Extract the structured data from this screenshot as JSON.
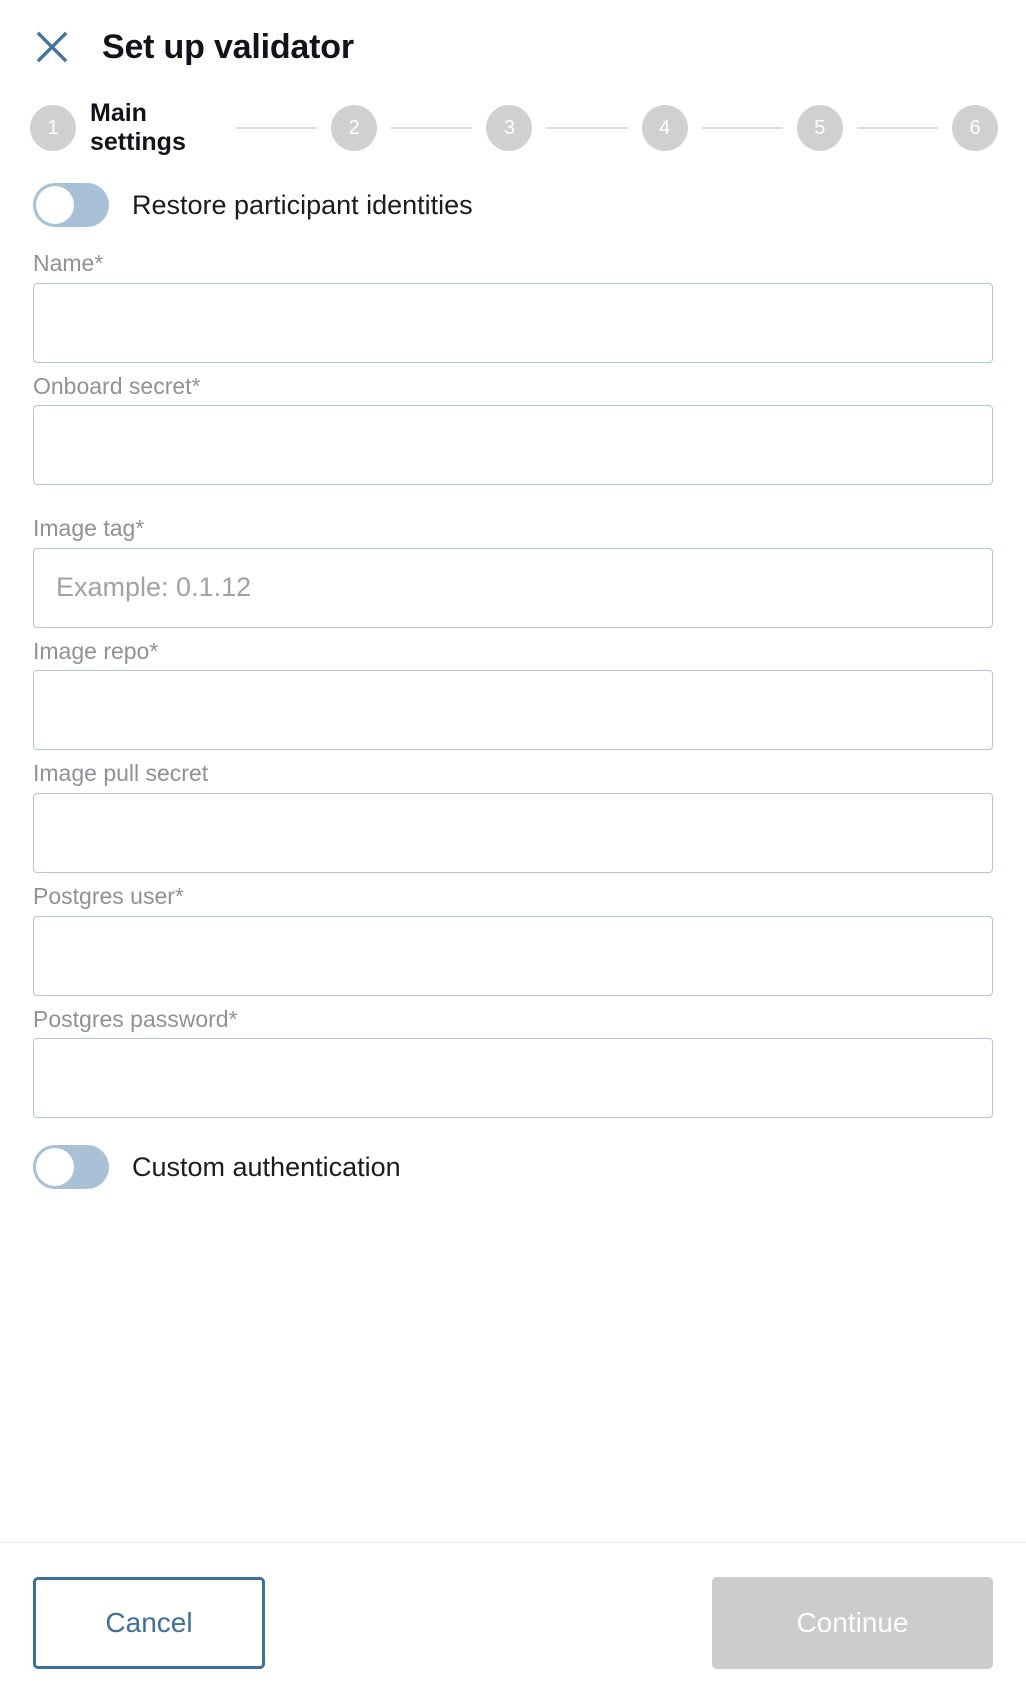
{
  "header": {
    "close_icon": "close-icon",
    "title": "Set up validator"
  },
  "stepper": {
    "current_step": 1,
    "steps": [
      {
        "number": "1",
        "label": "Main settings",
        "active": true
      },
      {
        "number": "2",
        "label": "",
        "active": false
      },
      {
        "number": "3",
        "label": "",
        "active": false
      },
      {
        "number": "4",
        "label": "",
        "active": false
      },
      {
        "number": "5",
        "label": "",
        "active": false
      },
      {
        "number": "6",
        "label": "",
        "active": false
      }
    ]
  },
  "form": {
    "restore_toggle": {
      "label": "Restore participant identities",
      "value": "off"
    },
    "fields": [
      {
        "label": "Name*",
        "value": "",
        "placeholder": ""
      },
      {
        "label": "Onboard secret*",
        "value": "",
        "placeholder": ""
      },
      {
        "label": "Image tag*",
        "value": "",
        "placeholder": "Example: 0.1.12"
      },
      {
        "label": "Image repo*",
        "value": "",
        "placeholder": ""
      },
      {
        "label": "Image pull secret",
        "value": "",
        "placeholder": ""
      },
      {
        "label": "Postgres user*",
        "value": "",
        "placeholder": ""
      },
      {
        "label": "Postgres password*",
        "value": "",
        "placeholder": ""
      }
    ],
    "custom_auth_toggle": {
      "label": "Custom authentication",
      "value": "off"
    }
  },
  "footer": {
    "cancel_label": "Cancel",
    "continue_label": "Continue",
    "continue_disabled": true
  },
  "colors": {
    "accent_blue": "#3c6f9c",
    "field_border": "#afc8dd",
    "toggle_track": "#a8c1d6",
    "step_circle": "#d0d0d0",
    "label_gray": "#8e9297",
    "disabled_button": "#cccccc"
  }
}
